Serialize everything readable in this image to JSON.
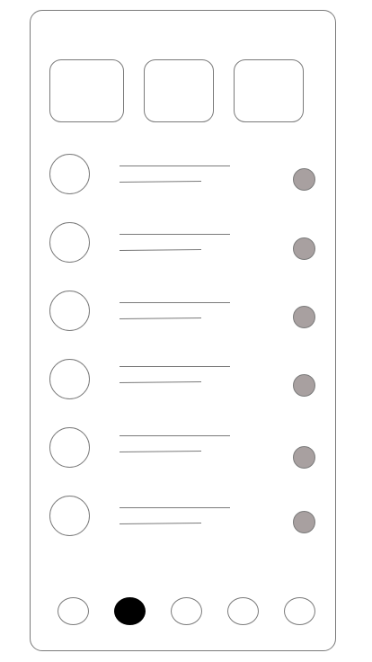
{
  "top_cards": [
    {
      "label": ""
    },
    {
      "label": ""
    },
    {
      "label": ""
    }
  ],
  "list_items": [
    {
      "title": "",
      "subtitle": "",
      "status_color": "#a8a0a0"
    },
    {
      "title": "",
      "subtitle": "",
      "status_color": "#a8a0a0"
    },
    {
      "title": "",
      "subtitle": "",
      "status_color": "#a8a0a0"
    },
    {
      "title": "",
      "subtitle": "",
      "status_color": "#a8a0a0"
    },
    {
      "title": "",
      "subtitle": "",
      "status_color": "#a8a0a0"
    },
    {
      "title": "",
      "subtitle": "",
      "status_color": "#a8a0a0"
    }
  ],
  "bottom_nav": {
    "active_index": 1,
    "items": [
      {
        "label": ""
      },
      {
        "label": ""
      },
      {
        "label": ""
      },
      {
        "label": ""
      },
      {
        "label": ""
      }
    ]
  },
  "colors": {
    "outline": "#7a7a7a",
    "status_dot": "#a8a0a0",
    "active_nav": "#000000",
    "background": "#ffffff"
  }
}
